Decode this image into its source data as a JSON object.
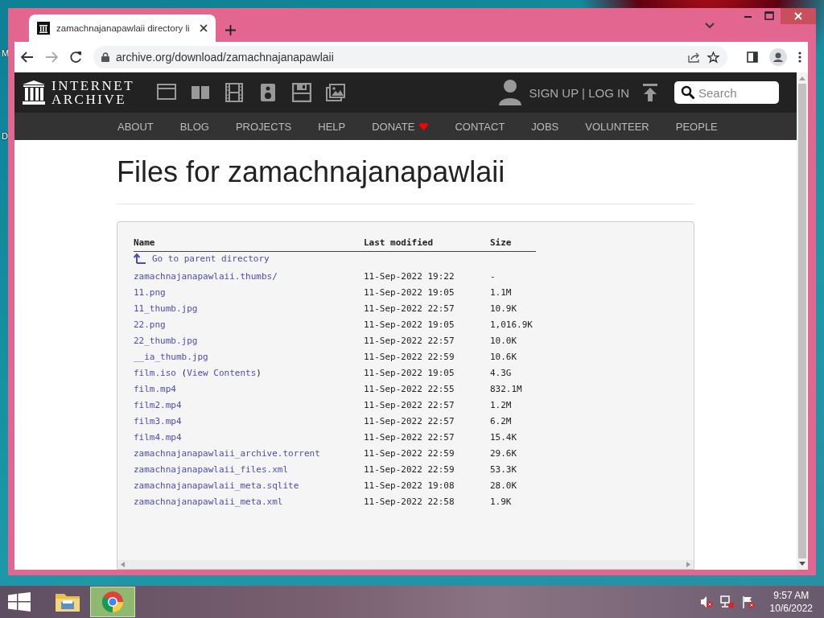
{
  "desktop_labels": [
    "M",
    "D"
  ],
  "browser": {
    "tabs": [
      {
        "title": "zamachnajanapawlaii directory li",
        "selected": true
      }
    ],
    "address": "archive.org/download/zamachnajanapawlaii"
  },
  "site": {
    "logo": [
      "INTERNET",
      "ARCHIVE"
    ],
    "account": "SIGN UP | LOG IN",
    "search": {
      "placeholder": "Search"
    },
    "nav": [
      {
        "label": "ABOUT",
        "heart": false
      },
      {
        "label": "BLOG",
        "heart": false
      },
      {
        "label": "PROJECTS",
        "heart": false
      },
      {
        "label": "HELP",
        "heart": false
      },
      {
        "label": "DONATE",
        "heart": true
      },
      {
        "label": "CONTACT",
        "heart": false
      },
      {
        "label": "JOBS",
        "heart": false
      },
      {
        "label": "VOLUNTEER",
        "heart": false
      },
      {
        "label": "PEOPLE",
        "heart": false
      }
    ]
  },
  "heading": "Files for zamachnajanapawlaii",
  "table": {
    "columns": [
      "Name",
      "Last modified",
      "Size"
    ],
    "parent_link": "Go to parent directory",
    "rows": [
      {
        "name": "zamachnajanapawlaii.thumbs/",
        "modified": "11-Sep-2022 19:22",
        "size": "-"
      },
      {
        "name": "11.png",
        "modified": "11-Sep-2022 19:05",
        "size": "1.1M"
      },
      {
        "name": "11_thumb.jpg",
        "modified": "11-Sep-2022 22:57",
        "size": "10.9K"
      },
      {
        "name": "22.png",
        "modified": "11-Sep-2022 19:05",
        "size": "1,016.9K"
      },
      {
        "name": "22_thumb.jpg",
        "modified": "11-Sep-2022 22:57",
        "size": "10.0K"
      },
      {
        "name": "__ia_thumb.jpg",
        "modified": "11-Sep-2022 22:59",
        "size": "10.6K"
      },
      {
        "name": "film.iso",
        "contents": {
          "before": "(",
          "link": "View Contents",
          "after": ")"
        },
        "modified": "11-Sep-2022 19:05",
        "size": "4.3G"
      },
      {
        "name": "film.mp4",
        "modified": "11-Sep-2022 22:55",
        "size": "832.1M"
      },
      {
        "name": "film2.mp4",
        "modified": "11-Sep-2022 22:57",
        "size": "1.2M"
      },
      {
        "name": "film3.mp4",
        "modified": "11-Sep-2022 22:57",
        "size": "6.2M"
      },
      {
        "name": "film4.mp4",
        "modified": "11-Sep-2022 22:57",
        "size": "15.4K"
      },
      {
        "name": "zamachnajanapawlaii_archive.torrent",
        "modified": "11-Sep-2022 22:59",
        "size": "29.6K"
      },
      {
        "name": "zamachnajanapawlaii_files.xml",
        "modified": "11-Sep-2022 22:59",
        "size": "53.3K"
      },
      {
        "name": "zamachnajanapawlaii_meta.sqlite",
        "modified": "11-Sep-2022 19:08",
        "size": "28.0K"
      },
      {
        "name": "zamachnajanapawlaii_meta.xml",
        "modified": "11-Sep-2022 22:58",
        "size": "1.9K"
      }
    ]
  },
  "taskbar": {
    "apps": [
      {
        "kind": "explorer",
        "selected": false
      },
      {
        "kind": "chrome",
        "selected": true
      }
    ],
    "time": "9:57 AM",
    "date": "10/6/2022"
  }
}
